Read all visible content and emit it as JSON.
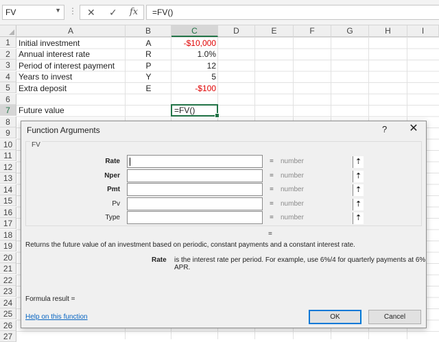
{
  "formula_bar": {
    "name_box": "FV",
    "dots": "⋮",
    "cancel_icon": "✕",
    "enter_icon": "✓",
    "fx_icon": "fx",
    "formula": "=FV()"
  },
  "columns": [
    "A",
    "B",
    "C",
    "D",
    "E",
    "F",
    "G",
    "H",
    "I"
  ],
  "selected_column": "C",
  "rows": [
    "1",
    "2",
    "3",
    "4",
    "5",
    "6",
    "7",
    "8",
    "9",
    "10",
    "11",
    "12",
    "13",
    "14",
    "15",
    "16",
    "17",
    "18",
    "19",
    "20",
    "21",
    "22",
    "23",
    "24",
    "25",
    "26",
    "27"
  ],
  "selected_row": "7",
  "cells": [
    {
      "a": "Initial investment",
      "b": "A",
      "c": "-$10,000",
      "neg": true
    },
    {
      "a": "Annual interest rate",
      "b": "R",
      "c": "1.0%",
      "neg": false
    },
    {
      "a": "Period of interest payment",
      "b": "P",
      "c": "12",
      "neg": false
    },
    {
      "a": "Years to invest",
      "b": "Y",
      "c": "5",
      "neg": false
    },
    {
      "a": "Extra deposit",
      "b": "E",
      "c": "-$100",
      "neg": true
    }
  ],
  "future_value": {
    "label": "Future value",
    "formula": "=FV()"
  },
  "dialog": {
    "title": "Function Arguments",
    "help": "?",
    "close": "✕",
    "function_name": "FV",
    "arguments": [
      {
        "label": "Rate",
        "bold": true,
        "eq": "=",
        "value": "number"
      },
      {
        "label": "Nper",
        "bold": true,
        "eq": "=",
        "value": "number"
      },
      {
        "label": "Pmt",
        "bold": true,
        "eq": "=",
        "value": "number"
      },
      {
        "label": "Pv",
        "bold": false,
        "eq": "=",
        "value": "number"
      },
      {
        "label": "Type",
        "bold": false,
        "eq": "=",
        "value": "number"
      }
    ],
    "result_eq": "=",
    "description": "Returns the future value of an investment based on periodic, constant payments and a constant interest rate.",
    "arg_description_label": "Rate",
    "arg_description": "is the interest rate per period. For example, use 6%/4 for quarterly payments at 6% APR.",
    "formula_result": "Formula result =",
    "help_link": "Help on this function",
    "ok_label": "OK",
    "cancel_label": "Cancel"
  }
}
